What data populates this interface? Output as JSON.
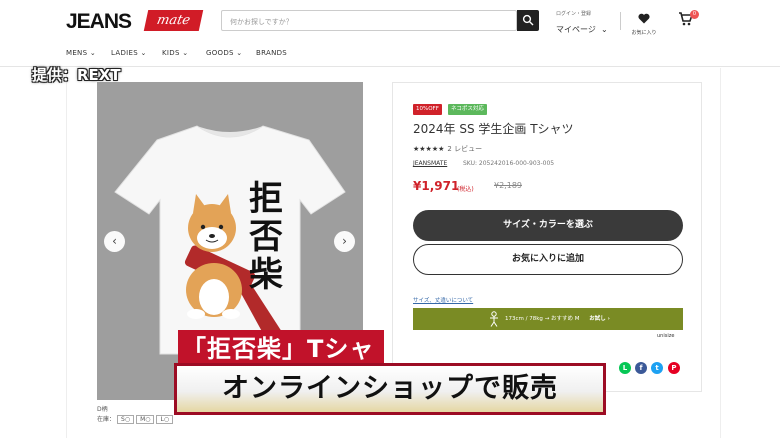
{
  "header": {
    "logo_text": "JEANS",
    "logo_badge": "mate",
    "search_placeholder": "何かお探しですか？",
    "login_label": "ログイン・登録",
    "mypage_label": "マイページ",
    "favorites_label": "お気に入り",
    "cart_count": "0"
  },
  "nav": {
    "items": [
      "MENS",
      "LADIES",
      "KIDS",
      "GOODS",
      "BRANDS"
    ]
  },
  "credit": "提供：REXT",
  "gallery": {
    "prev_label": "‹",
    "next_label": "›",
    "shirt_text": [
      "拒",
      "否",
      "柴"
    ],
    "pattern_label": "D柄",
    "caption": "D柄",
    "stock_label": "在庫：",
    "stock_sizes": [
      "S○",
      "M○",
      "L○"
    ]
  },
  "product": {
    "tag_sale": "10%OFF",
    "tag_nekopos": "ネコポス対応",
    "title": "2024年 SS 学生企画 Tシャツ",
    "stars": "★★★★★",
    "review_count": "2 レビュー",
    "brand": "JEANSMATE",
    "sku": "SKU: 205242016-000-903-005",
    "price": "¥1,971",
    "tax_note": "(税込)",
    "old_price": "¥2,189",
    "select_button": "サイズ・カラーを選ぶ",
    "favorite_button": "お気に入りに追加",
    "size_link": "サイズ、丈違いについて",
    "unisize_text": "173cm / 78kg → おすすめ M",
    "unisize_cta": "お試し ›",
    "unisize_logo": "unisize"
  },
  "overlay": {
    "caption_top": "「拒否柴」Tシャツ",
    "caption_main": "オンラインショップで販売"
  },
  "colors": {
    "accent_red": "#d0222a",
    "unisize_green": "#7a8b24",
    "caption_red": "#c1122a"
  }
}
